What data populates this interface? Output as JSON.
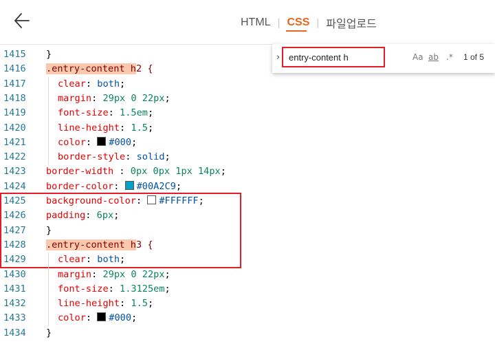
{
  "header": {
    "tabs": [
      {
        "label": "HTML"
      },
      {
        "label": "CSS"
      },
      {
        "label": "파일업로드"
      }
    ]
  },
  "find": {
    "query": "entry-content h",
    "match_case_label": "Aa",
    "whole_word_label": "ab",
    "regex_label": ".*",
    "count": "1 of 5"
  },
  "colors": {
    "accent": "#e8641c",
    "highlight_box": "#e11d2a",
    "swatch_black": "#000000",
    "swatch_teal": "#00A2C9",
    "swatch_white": "#FFFFFF"
  },
  "code": {
    "lines": [
      {
        "num": "1415",
        "close": "}"
      },
      {
        "num": "1416",
        "sel": ".entry-content h",
        "rest": "2 {"
      },
      {
        "num": "1417",
        "prop": "clear",
        "val": "both"
      },
      {
        "num": "1418",
        "prop": "margin",
        "val": "29px 0 22px"
      },
      {
        "num": "1419",
        "prop": "font-size",
        "val": "1.5em"
      },
      {
        "num": "1420",
        "prop": "line-height",
        "val": "1.5"
      },
      {
        "num": "1421",
        "prop": "color",
        "val": "#000"
      },
      {
        "num": "1422",
        "prop": "border-style",
        "val": "solid"
      },
      {
        "num": "1423",
        "prop": "border-width ",
        "val": "0px 0px 1px 14px"
      },
      {
        "num": "1424",
        "prop": "border-color",
        "val": "#00A2C9"
      },
      {
        "num": "1425",
        "prop": "background-color",
        "val": "#FFFFFF"
      },
      {
        "num": "1426",
        "prop": "padding",
        "val": "6px"
      },
      {
        "num": "1427",
        "close": "}"
      },
      {
        "num": "1428",
        "sel": ".entry-content h",
        "rest": "3 {"
      },
      {
        "num": "1429",
        "prop": "clear",
        "val": "both"
      },
      {
        "num": "1430",
        "prop": "margin",
        "val": "29px 0 22px"
      },
      {
        "num": "1431",
        "prop": "font-size",
        "val": "1.3125em"
      },
      {
        "num": "1432",
        "prop": "line-height",
        "val": "1.5"
      },
      {
        "num": "1433",
        "prop": "color",
        "val": "#000"
      },
      {
        "num": "1434",
        "close": "}"
      }
    ]
  }
}
